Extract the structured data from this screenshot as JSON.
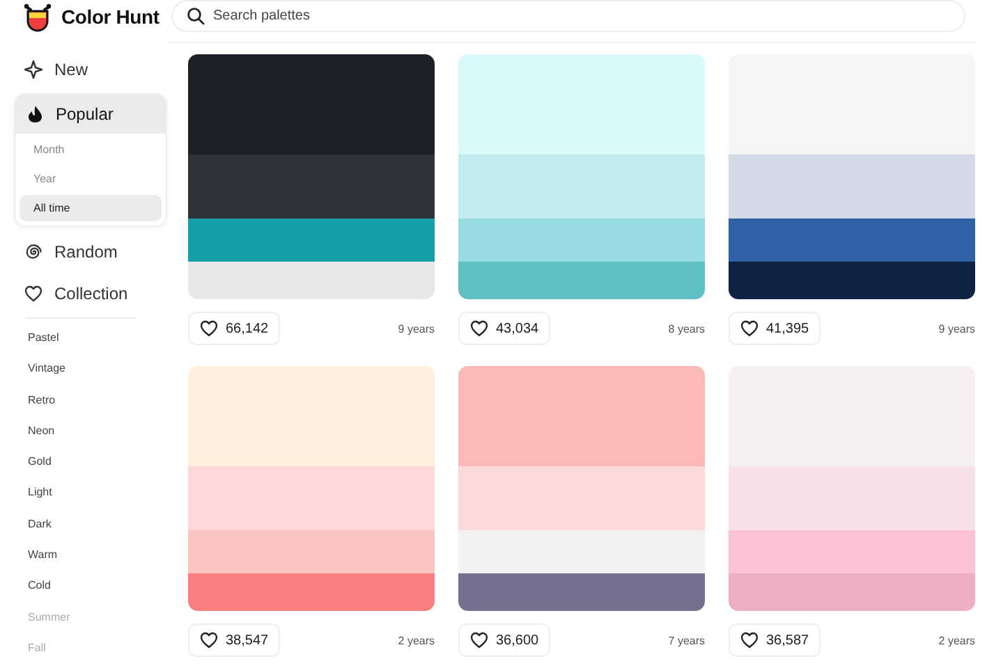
{
  "brand": "Color Hunt",
  "search": {
    "placeholder": "Search palettes"
  },
  "nav": [
    {
      "label": "New",
      "kind": "new",
      "selected": false
    },
    {
      "label": "Popular",
      "kind": "popular",
      "selected": true,
      "expanded": true,
      "children": [
        {
          "label": "Month",
          "selected": false
        },
        {
          "label": "Year",
          "selected": false
        },
        {
          "label": "All time",
          "selected": true
        }
      ]
    },
    {
      "label": "Random",
      "kind": "random",
      "selected": false
    },
    {
      "label": "Collection",
      "kind": "collection",
      "selected": false
    }
  ],
  "tags": [
    {
      "label": "Pastel",
      "faded": false
    },
    {
      "label": "Vintage",
      "faded": false
    },
    {
      "label": "Retro",
      "faded": false
    },
    {
      "label": "Neon",
      "faded": false
    },
    {
      "label": "Gold",
      "faded": false
    },
    {
      "label": "Light",
      "faded": false
    },
    {
      "label": "Dark",
      "faded": false
    },
    {
      "label": "Warm",
      "faded": false
    },
    {
      "label": "Cold",
      "faded": false
    },
    {
      "label": "Summer",
      "faded": true
    },
    {
      "label": "Fall",
      "faded": true
    }
  ],
  "palettes": [
    {
      "swatches": [
        {
          "color": "#1c2027"
        },
        {
          "color": "#2e323a"
        },
        {
          "color": "#13a0a8"
        },
        {
          "color": "#e8e8e8"
        }
      ],
      "likes": "66,142",
      "age": "9 years"
    },
    {
      "swatches": [
        {
          "color": "#d8fafa"
        },
        {
          "color": "#c2ebf0"
        },
        {
          "color": "#95dbe0"
        },
        {
          "color": "#60bfc3"
        }
      ],
      "likes": "43,034",
      "age": "8 years"
    },
    {
      "swatches": [
        {
          "color": "#f6f4f5"
        },
        {
          "color": "#d3dbe9"
        },
        {
          "color": "#3060a5"
        },
        {
          "color": "#112344"
        }
      ],
      "likes": "41,395",
      "age": "9 years"
    },
    {
      "swatches": [
        {
          "color": "#fdf0de"
        },
        {
          "color": "#fed8d8"
        },
        {
          "color": "#fbc2c2"
        },
        {
          "color": "#fb7f80"
        }
      ],
      "likes": "38,547",
      "age": "2 years"
    },
    {
      "swatches": [
        {
          "color": "#fbb9b8"
        },
        {
          "color": "#fdd8d8"
        },
        {
          "color": "#f3f2f2"
        },
        {
          "color": "#76708f"
        }
      ],
      "likes": "36,600",
      "age": "7 years"
    },
    {
      "swatches": [
        {
          "color": "#f7f0f2"
        },
        {
          "color": "#f5e1e7"
        },
        {
          "color": "#fbc2d6"
        },
        {
          "color": "#edaec6"
        }
      ],
      "likes": "36,587",
      "age": "2 years"
    }
  ]
}
